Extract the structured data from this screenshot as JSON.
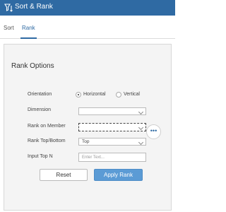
{
  "window": {
    "title": "Sort & Rank"
  },
  "tabs": [
    {
      "label": "Sort"
    },
    {
      "label": "Rank"
    }
  ],
  "panel": {
    "title": "Rank Options",
    "orientation": {
      "label": "Orientation",
      "options": [
        {
          "label": "Horizontal",
          "selected": true
        },
        {
          "label": "Vertical",
          "selected": false
        }
      ]
    },
    "dimension": {
      "label": "Dimension",
      "value": ""
    },
    "rank_on_member": {
      "label": "Rank on Member",
      "value": ""
    },
    "rank_top_bottom": {
      "label": "Rank Top/Bottom",
      "value": "Top"
    },
    "input_top_n": {
      "label": "Input Top N",
      "placeholder": "Enter Text..."
    },
    "more_button": {
      "label": "•••"
    },
    "buttons": {
      "reset": "Reset",
      "apply": "Apply Rank"
    }
  },
  "colors": {
    "accent": "#2f6aa3",
    "apply_button": "#5b9bd5",
    "panel_bg": "#f4f4f4"
  }
}
